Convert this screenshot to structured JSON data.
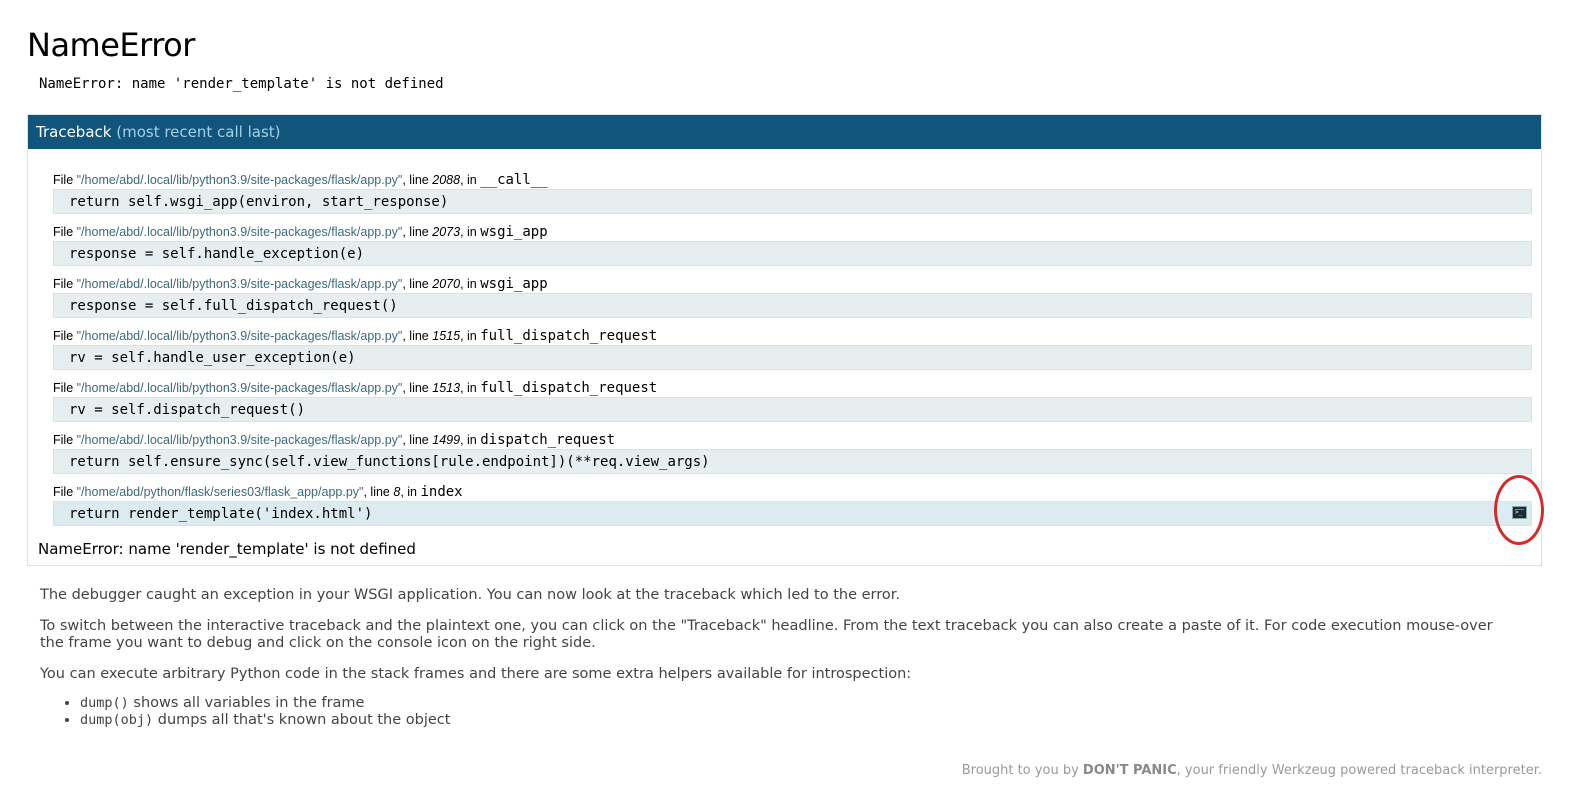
{
  "title": "NameError",
  "error_message": "NameError: name 'render_template' is not defined",
  "traceback": {
    "heading": "Traceback",
    "heading_sub": "(most recent call last)",
    "frames": [
      {
        "prefix": "File ",
        "filename": "\"/home/abd/.local/lib/python3.9/site-packages/flask/app.py\"",
        "line_label": ", line ",
        "line": "2088",
        "in_label": ", in ",
        "function": "__call__",
        "code": "return self.wsgi_app(environ, start_response)"
      },
      {
        "prefix": "File ",
        "filename": "\"/home/abd/.local/lib/python3.9/site-packages/flask/app.py\"",
        "line_label": ", line ",
        "line": "2073",
        "in_label": ", in ",
        "function": "wsgi_app",
        "code": "response = self.handle_exception(e)"
      },
      {
        "prefix": "File ",
        "filename": "\"/home/abd/.local/lib/python3.9/site-packages/flask/app.py\"",
        "line_label": ", line ",
        "line": "2070",
        "in_label": ", in ",
        "function": "wsgi_app",
        "code": "response = self.full_dispatch_request()"
      },
      {
        "prefix": "File ",
        "filename": "\"/home/abd/.local/lib/python3.9/site-packages/flask/app.py\"",
        "line_label": ", line ",
        "line": "1515",
        "in_label": ", in ",
        "function": "full_dispatch_request",
        "code": "rv = self.handle_user_exception(e)"
      },
      {
        "prefix": "File ",
        "filename": "\"/home/abd/.local/lib/python3.9/site-packages/flask/app.py\"",
        "line_label": ", line ",
        "line": "1513",
        "in_label": ", in ",
        "function": "full_dispatch_request",
        "code": "rv = self.dispatch_request()"
      },
      {
        "prefix": "File ",
        "filename": "\"/home/abd/.local/lib/python3.9/site-packages/flask/app.py\"",
        "line_label": ", line ",
        "line": "1499",
        "in_label": ", in ",
        "function": "dispatch_request",
        "code": "return self.ensure_sync(self.view_functions[rule.endpoint])(**req.view_args)"
      },
      {
        "prefix": "File ",
        "filename": "\"/home/abd/python/flask/series03/flask_app/app.py\"",
        "line_label": ", line ",
        "line": "8",
        "in_label": ", in ",
        "function": "index",
        "code": "return render_template('index.html')"
      }
    ],
    "exception_line": "NameError: name 'render_template' is not defined"
  },
  "explanation": {
    "p1": "The debugger caught an exception in your WSGI application. You can now look at the traceback which led to the error.",
    "p2": "To switch between the interactive traceback and the plaintext one, you can click on the \"Traceback\" headline. From the text traceback you can also create a paste of it. For code execution mouse-over the frame you want to debug and click on the console icon on the right side.",
    "p3": "You can execute arbitrary Python code in the stack frames and there are some extra helpers available for introspection:",
    "helpers": [
      {
        "code": "dump()",
        "text": " shows all variables in the frame"
      },
      {
        "code": "dump(obj)",
        "text": " dumps all that's known about the object"
      }
    ]
  },
  "footer": {
    "pre": "Brought to you by ",
    "brand": "DON'T PANIC",
    "post": ", your friendly Werkzeug powered traceback interpreter."
  },
  "icons": {
    "console": "console-icon"
  },
  "colors": {
    "header_bg": "#11557c",
    "code_bg": "#e6eef0",
    "highlight_ring": "#d42a2a"
  }
}
